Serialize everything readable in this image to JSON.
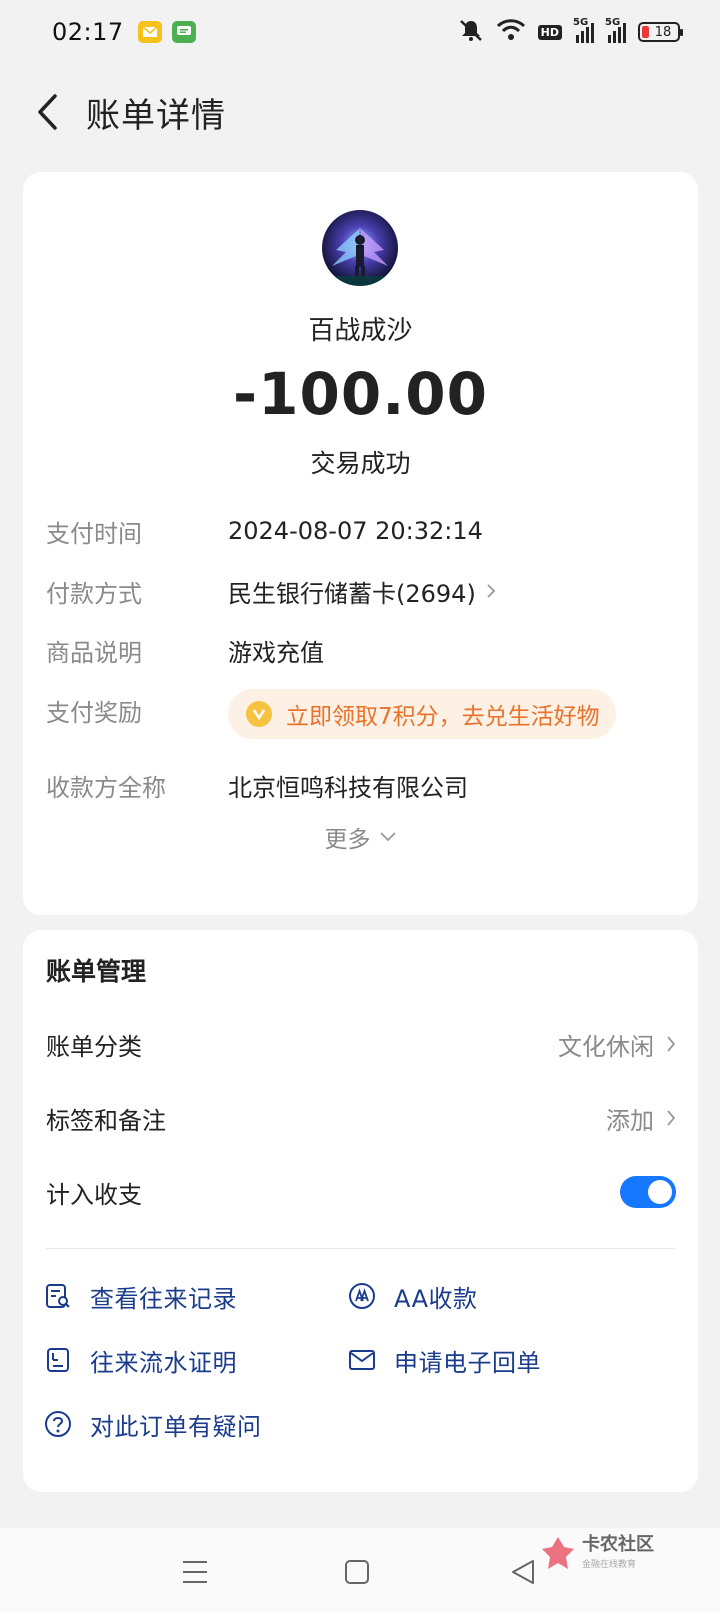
{
  "status_bar": {
    "time": "02:17",
    "battery_level": "18",
    "network_label_1": "5G",
    "network_label_2": "5G",
    "hd_label": "HD"
  },
  "header": {
    "title": "账单详情"
  },
  "transaction": {
    "merchant_name": "百战成沙",
    "amount": "-100.00",
    "status": "交易成功"
  },
  "details": [
    {
      "label": "支付时间",
      "value": "2024-08-07 20:32:14"
    },
    {
      "label": "付款方式",
      "value": "民生银行储蓄卡(2694)"
    },
    {
      "label": "商品说明",
      "value": "游戏充值"
    },
    {
      "label": "支付奖励",
      "value": "立即领取7积分，去兑生活好物"
    },
    {
      "label": "收款方全称",
      "value": "北京恒鸣科技有限公司"
    }
  ],
  "more_label": "更多",
  "manage": {
    "title": "账单管理",
    "category_label": "账单分类",
    "category_value": "文化休闲",
    "tags_label": "标签和备注",
    "tags_value": "添加",
    "include_label": "计入收支",
    "include_enabled": true
  },
  "actions": [
    {
      "label": "查看往来记录",
      "icon": "records-search-icon"
    },
    {
      "label": "AA收款",
      "icon": "aa-icon"
    },
    {
      "label": "往来流水证明",
      "icon": "statement-icon"
    },
    {
      "label": "申请电子回单",
      "icon": "envelope-icon"
    },
    {
      "label": "对此订单有疑问",
      "icon": "question-icon"
    }
  ],
  "watermark": {
    "title": "卡农社区",
    "subtitle": "金融在线教育"
  },
  "colors": {
    "accent": "#1677ff",
    "reward_text": "#e8732c",
    "reward_bg": "#fdf1e6",
    "action_text": "#1b3c8c"
  }
}
